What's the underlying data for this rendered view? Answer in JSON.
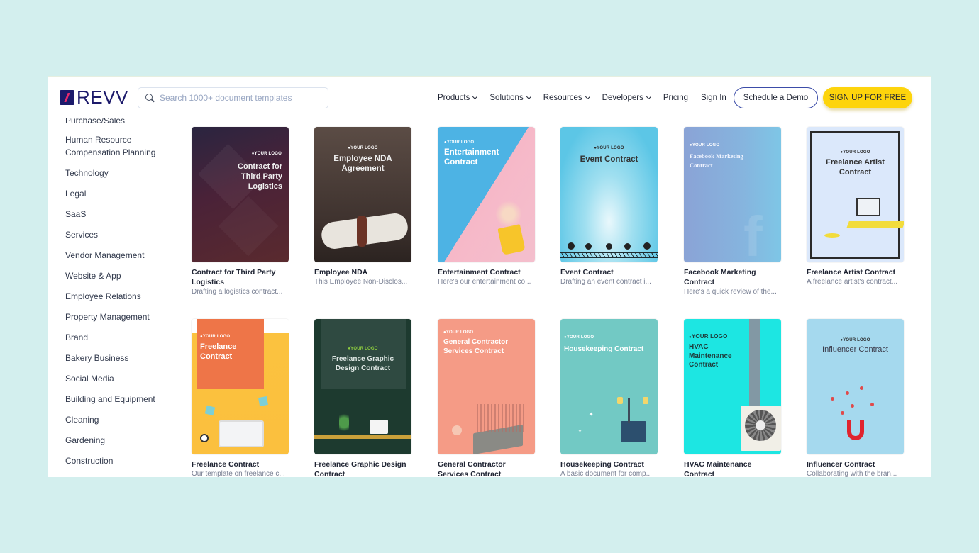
{
  "header": {
    "logo_text": "REVV",
    "search_placeholder": "Search 1000+ document templates",
    "nav": [
      {
        "label": "Products",
        "dropdown": true
      },
      {
        "label": "Solutions",
        "dropdown": true
      },
      {
        "label": "Resources",
        "dropdown": true
      },
      {
        "label": "Developers",
        "dropdown": true
      },
      {
        "label": "Pricing",
        "dropdown": false
      },
      {
        "label": "Sign In",
        "dropdown": false
      }
    ],
    "demo_button": "Schedule a Demo",
    "signup_button": "SIGN UP FOR FREE"
  },
  "sidebar": {
    "categories": [
      "Purchase/Sales",
      "Human Resource Compensation Planning",
      "Technology",
      "Legal",
      "SaaS",
      "Services",
      "Vendor Management",
      "Website & App",
      "Employee Relations",
      "Property Management",
      "Brand",
      "Bakery Business",
      "Social Media",
      "Building and Equipment",
      "Cleaning",
      "Gardening",
      "Construction"
    ]
  },
  "logo_placeholder": "YOUR LOGO",
  "templates": [
    {
      "title": "Contract for Third Party Logistics",
      "desc": "Drafting a logistics contract...",
      "cover_title": "Contract for Third Party Logistics",
      "bg": "#3a1f3a"
    },
    {
      "title": "Employee NDA",
      "desc": "This Employee Non-Disclos...",
      "cover_title": "Employee NDA Agreement",
      "bg": "#4a3b36"
    },
    {
      "title": "Entertainment Contract",
      "desc": "Here's our entertainment co...",
      "cover_title": "Entertainment Contract",
      "bg": "#4fb6e3"
    },
    {
      "title": "Event Contract",
      "desc": "Drafting an event contract i...",
      "cover_title": "Event Contract",
      "bg": "#6ccde8"
    },
    {
      "title": "Facebook Marketing Contract",
      "desc": "Here's a quick review of the...",
      "cover_title": "Facebook Marketing Contract",
      "bg": "#8aa6d6"
    },
    {
      "title": "Freelance Artist Contract",
      "desc": "A freelance artist's contract...",
      "cover_title": "Freelance Artist Contract",
      "bg": "#dbe8fb"
    },
    {
      "title": "Freelance Contract",
      "desc": "Our template on freelance c...",
      "cover_title": "Freelance Contract",
      "bg": "#fbc13f"
    },
    {
      "title": "Freelance Graphic Design Contract",
      "desc": "",
      "cover_title": "Freelance Graphic Design Contract",
      "bg": "#1e3a30"
    },
    {
      "title": "General Contractor Services Contract",
      "desc": "",
      "cover_title": "General Contractor Services Contract",
      "bg": "#f49b85"
    },
    {
      "title": "Housekeeping Contract",
      "desc": "A basic document for comp...",
      "cover_title": "Housekeeping Contract",
      "bg": "#72c9c4"
    },
    {
      "title": "HVAC Maintenance Contract",
      "desc": "",
      "cover_title": "HVAC Maintenance Contract",
      "bg": "#1ee5e0"
    },
    {
      "title": "Influencer Contract",
      "desc": "Collaborating with the bran...",
      "cover_title": "Influencer Contract",
      "bg": "#a5d9ee"
    }
  ]
}
